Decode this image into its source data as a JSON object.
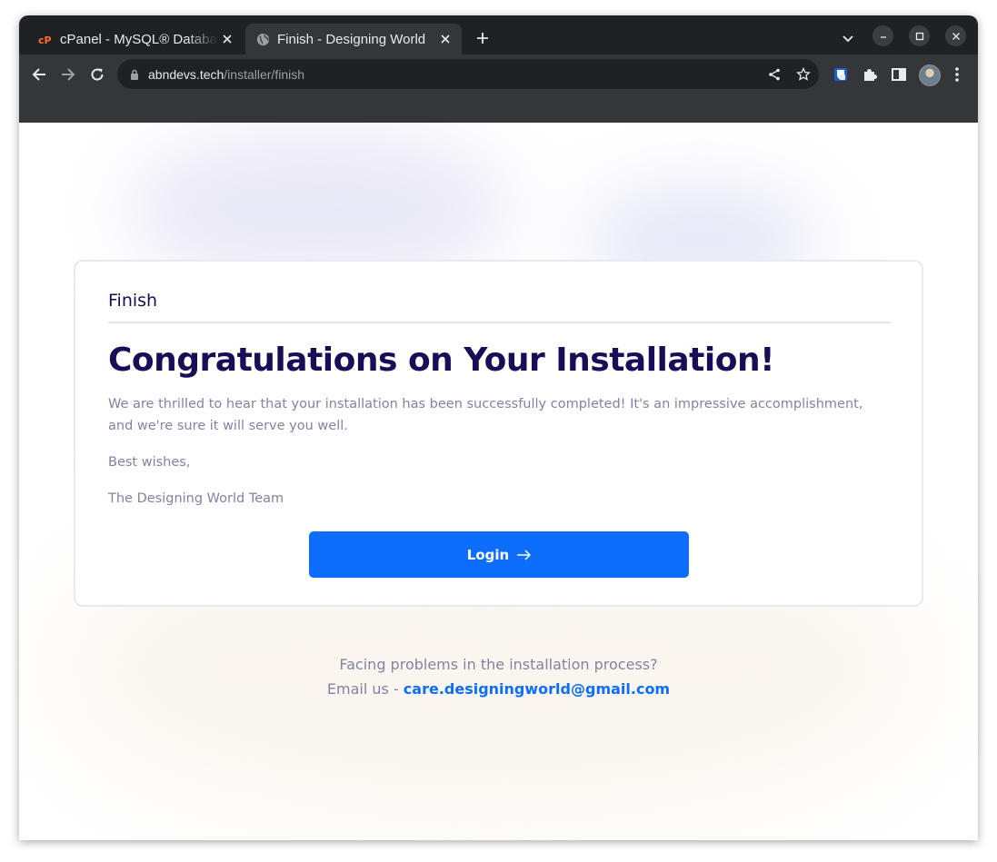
{
  "browser": {
    "tabs": [
      {
        "title": "cPanel - MySQL® Databases",
        "favicon": "cpanel-icon",
        "active": false
      },
      {
        "title": "Finish - Designing World",
        "favicon": "globe-icon",
        "active": true
      }
    ],
    "url": {
      "domain": "abndevs.tech",
      "path": "/installer/finish"
    }
  },
  "card": {
    "title": "Finish",
    "headline": "Congratulations on Your Installation!",
    "message": "We are thrilled to hear that your installation has been successfully completed! It's an impressive accomplishment, and we're sure it will serve you well.",
    "closing": "Best wishes,",
    "signature": "The Designing World Team",
    "login_label": "Login"
  },
  "footer": {
    "line1": "Facing problems in the installation process?",
    "line2_prefix": "Email us - ",
    "email": "care.designingworld@gmail.com"
  },
  "colors": {
    "primary": "#0d6efd",
    "heading": "#1b0c57",
    "muted_text": "#8282a4",
    "browser_dark": "#202124",
    "toolbar": "#35363a"
  }
}
